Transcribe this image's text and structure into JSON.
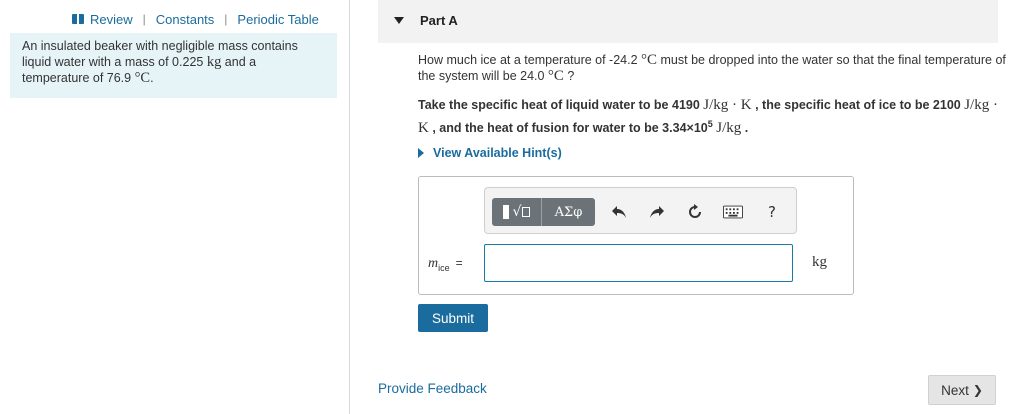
{
  "nav": {
    "review": "Review",
    "separator": "|",
    "constants": "Constants",
    "periodic_table": "Periodic Table"
  },
  "problem": {
    "text_before_mass": "An insulated beaker with negligible mass contains liquid water with a mass of 0.225 ",
    "mass_unit": "kg",
    "text_after_mass": " and a temperature of 76.9 ",
    "temp_unit": "°C",
    "end": "."
  },
  "part": {
    "title": "Part A",
    "question_before": "How much ice at a temperature of -24.2 ",
    "q_unit1": "°C",
    "question_middle": " must be dropped into the water so that the final temperature of the system will be 24.0 ",
    "q_unit2": "°C",
    "question_end": " ?",
    "specific_1": "Take the specific heat of liquid water to be 4190 ",
    "unit_jkgk_1": "J/kg · K",
    "specific_2": " , the specific heat of ice to be 2100 ",
    "unit_jkgk_2": "J/kg · K",
    "specific_3": " , and the heat of fusion for water to be 3.34×10",
    "exponent": "5",
    "specific_4": " ",
    "unit_jkg": "J/kg",
    "specific_end": " .",
    "hint_label": "View Available Hint(s)"
  },
  "toolbar": {
    "greek_label": "ΑΣφ",
    "undo_icon": "undo-icon",
    "redo_icon": "redo-icon",
    "reset_icon": "reset-icon",
    "keyboard_icon": "keyboard-icon",
    "help_label": "?"
  },
  "answer": {
    "var": "m",
    "sub": "ice",
    "eq": "=",
    "value": "",
    "unit": "kg"
  },
  "buttons": {
    "submit": "Submit",
    "feedback": "Provide Feedback",
    "next": "Next",
    "next_chevron": "❯"
  },
  "colors": {
    "link": "#1a6c9e",
    "problem_bg": "#e6f4f7",
    "header_bg": "#f2f2f2",
    "toolbar_btn": "#6c7378"
  }
}
